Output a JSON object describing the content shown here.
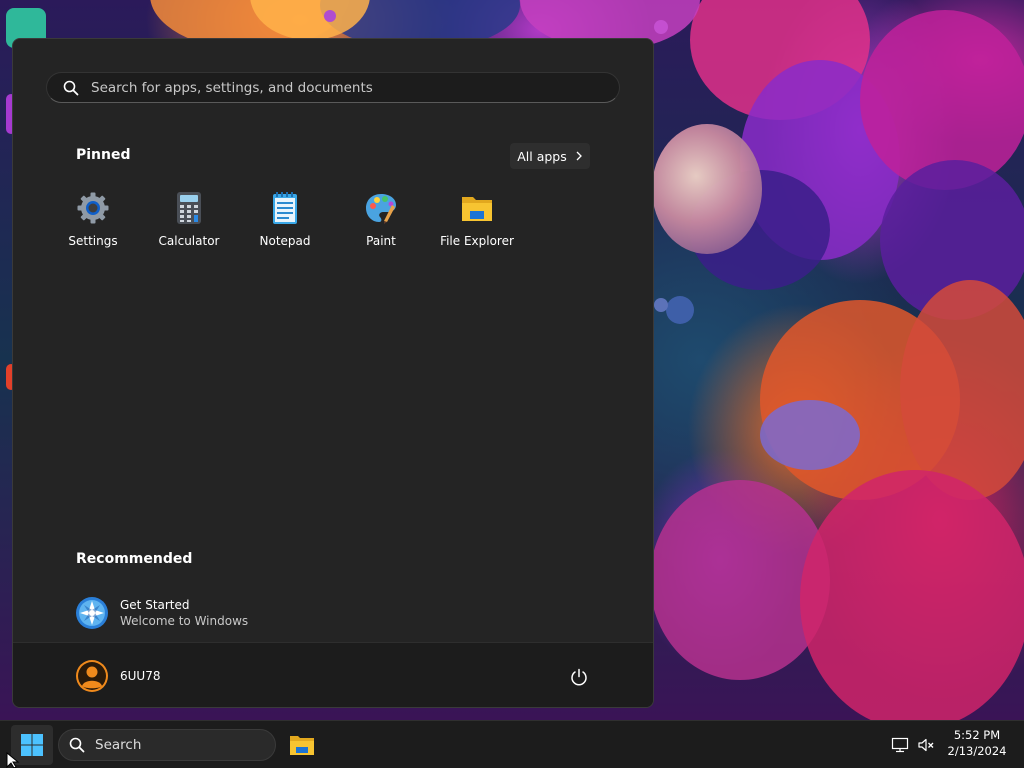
{
  "start_menu": {
    "search_placeholder": "Search for apps, settings, and documents",
    "pinned_title": "Pinned",
    "all_apps_label": "All apps",
    "pinned_apps": [
      {
        "label": "Settings",
        "icon": "settings-icon"
      },
      {
        "label": "Calculator",
        "icon": "calculator-icon"
      },
      {
        "label": "Notepad",
        "icon": "notepad-icon"
      },
      {
        "label": "Paint",
        "icon": "paint-icon"
      },
      {
        "label": "File Explorer",
        "icon": "file-explorer-icon"
      }
    ],
    "recommended_title": "Recommended",
    "recommended": [
      {
        "title": "Get Started",
        "subtitle": "Welcome to Windows",
        "icon": "get-started-icon"
      }
    ],
    "user_name": "6UU78",
    "power_icon": "power-icon"
  },
  "taskbar": {
    "search_label": "Search",
    "clock_time": "5:52 PM",
    "clock_date": "2/13/2024",
    "apps": [
      {
        "name": "File Explorer",
        "icon": "folder-icon"
      }
    ]
  },
  "colors": {
    "menu_bg": "#242424",
    "taskbar_bg": "#1c1c1c",
    "accent_blue": "#0a84ff",
    "folder_yellow": "#f7c431"
  }
}
